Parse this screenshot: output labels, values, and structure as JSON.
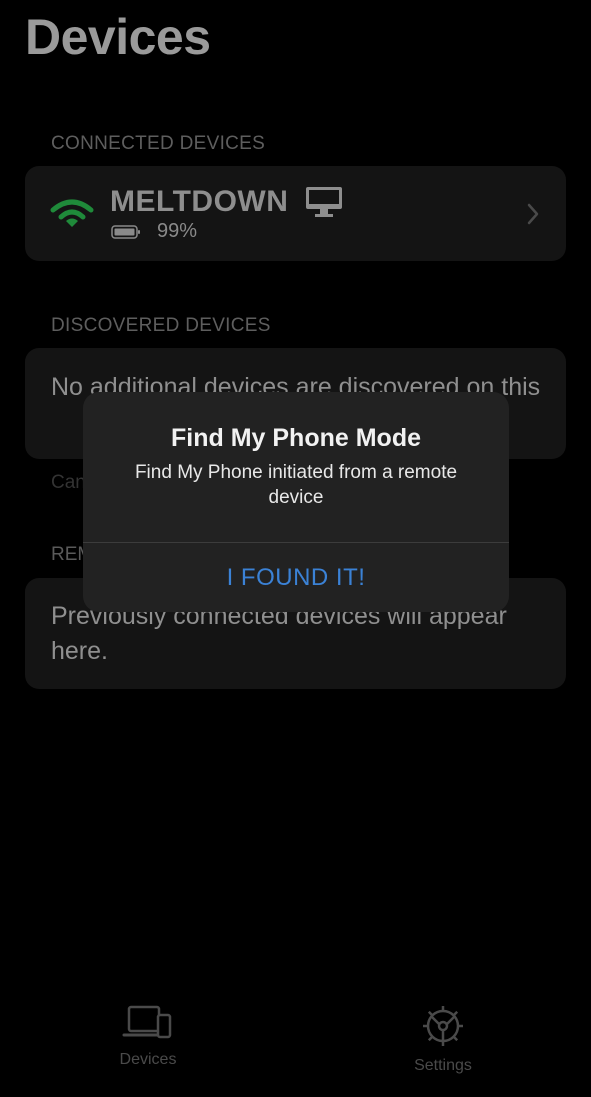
{
  "header": {
    "title": "Devices"
  },
  "connected": {
    "header": "CONNECTED DEVICES",
    "device": {
      "name": "MELTDOWN",
      "battery": "99%",
      "status_icon": "wifi-icon",
      "type_icon": "monitor-icon"
    }
  },
  "discovered": {
    "header": "DISCOVERED DEVICES",
    "message": "No additional devices are discovered on this",
    "footnote": "Can"
  },
  "remembered": {
    "header": "REM",
    "message": "Previously connected devices will appear here."
  },
  "alert": {
    "title": "Find My Phone Mode",
    "message": "Find My Phone initiated from a remote device",
    "button": "I FOUND IT!"
  },
  "tabs": [
    {
      "label": "Devices",
      "icon": "devices-icon"
    },
    {
      "label": "Settings",
      "icon": "settings-icon"
    }
  ],
  "colors": {
    "accent": "#3b82d6",
    "wifi": "#1f8a3a",
    "background": "#000000",
    "card": "#141414"
  }
}
